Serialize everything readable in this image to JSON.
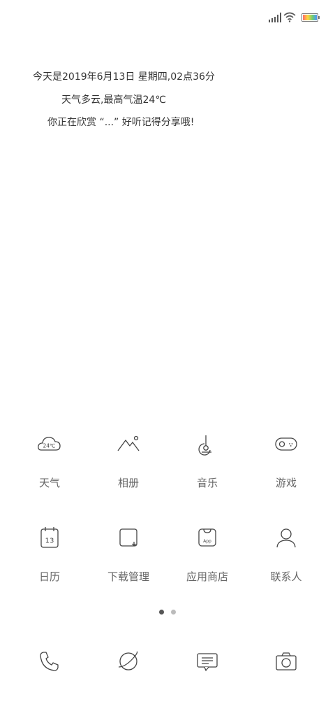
{
  "info": {
    "line1": "今天是2019年6月13日 星期四,02点36分",
    "line2": "天气多云,最高气温24℃",
    "line3": "你正在欣赏 “...” 好听记得分享哦!"
  },
  "weather_icon_text": "24℃",
  "calendar_icon_text": "13",
  "app_store_icon_text": "App",
  "apps_row1": [
    {
      "label": "天气",
      "icon": "weather-icon"
    },
    {
      "label": "相册",
      "icon": "gallery-icon"
    },
    {
      "label": "音乐",
      "icon": "music-icon"
    },
    {
      "label": "游戏",
      "icon": "game-icon"
    }
  ],
  "apps_row2": [
    {
      "label": "日历",
      "icon": "calendar-icon"
    },
    {
      "label": "下载管理",
      "icon": "download-icon"
    },
    {
      "label": "应用商店",
      "icon": "app-store-icon"
    },
    {
      "label": "联系人",
      "icon": "contact-icon"
    }
  ],
  "dock": [
    {
      "icon": "phone-icon"
    },
    {
      "icon": "browser-icon"
    },
    {
      "icon": "message-icon"
    },
    {
      "icon": "camera-icon"
    }
  ],
  "colors": {
    "text": "#333333",
    "label": "#666666",
    "icon_stroke": "#444444",
    "battery_gradient": [
      "#ff6b6b",
      "#ffd93d",
      "#6bcB77",
      "#4d96ff"
    ]
  }
}
